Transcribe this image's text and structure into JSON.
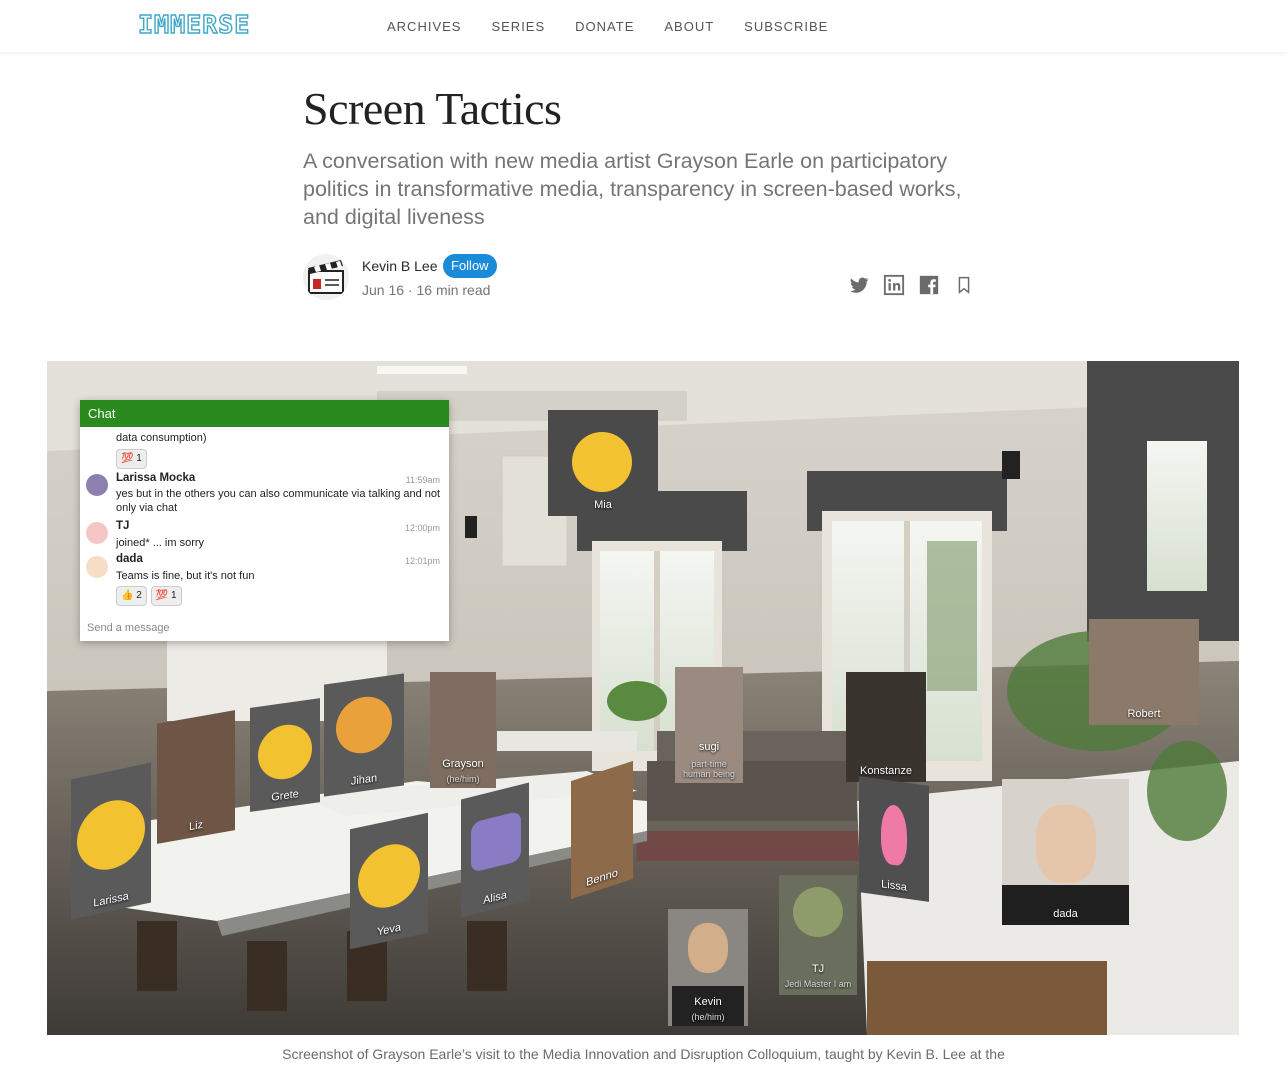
{
  "site": {
    "logo": "IMMERSE"
  },
  "nav": [
    "ARCHIVES",
    "SERIES",
    "DONATE",
    "ABOUT",
    "SUBSCRIBE"
  ],
  "article": {
    "title": "Screen Tactics",
    "subtitle": "A conversation with new media artist Grayson Earle on participatory politics in transformative media, transparency in screen-based works, and digital liveness",
    "author": "Kevin B Lee",
    "follow_label": "Follow",
    "meta": "Jun 16 · 16 min read",
    "share_icons": [
      "twitter-icon",
      "linkedin-icon",
      "facebook-icon",
      "bookmark-icon"
    ],
    "caption": "Screenshot of Grayson Earle’s visit to the Media Innovation and Disruption Colloquium, taught by Kevin B. Lee at the"
  },
  "chat": {
    "header": "Chat",
    "partial_line": "data consumption)",
    "top_reaction": "1",
    "messages": [
      {
        "name": "Larissa Mocka",
        "time": "11:59am",
        "text": "yes but in the others you can also communicate via talking and not only via chat"
      },
      {
        "name": "TJ",
        "time": "12:00pm",
        "text": "joined* ... im sorry"
      },
      {
        "name": "dada",
        "time": "12:01pm",
        "text": "Teams is fine, but it's not fun"
      }
    ],
    "reactions": [
      "2",
      "1"
    ],
    "input_placeholder": "Send a message"
  },
  "participants": {
    "mia": "Mia",
    "robert": "Robert",
    "sugi": "sugi",
    "sugi_sub": "part-time human being",
    "konstanze": "Konstanze",
    "grayson": "Grayson",
    "grayson_sub": "(he/him)",
    "jihan": "Jihan",
    "grete": "Grete",
    "liz": "Liz",
    "larissa": "Larissa",
    "yeva": "Yeva",
    "alisa": "Alisa",
    "benno": "Benno",
    "lissa": "Lissa",
    "dada": "dada",
    "tj": "TJ",
    "tj_sub": "Jedi Master I am",
    "kevin": "Kevin",
    "kevin_sub": "(he/him)"
  },
  "colors": {
    "follow": "#1a8bd8",
    "chat_header": "#2b8a1e",
    "logo": "#3fa8c8"
  }
}
